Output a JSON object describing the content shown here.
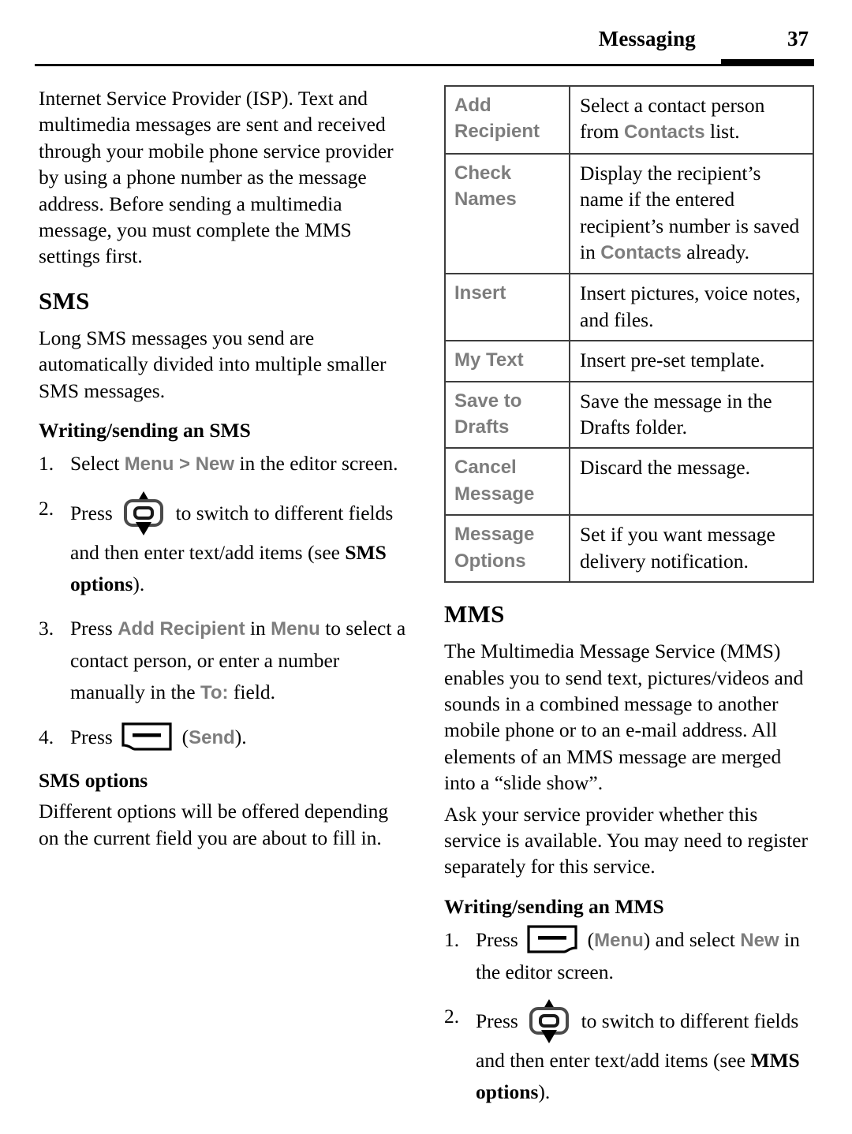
{
  "header": {
    "title": "Messaging",
    "page_number": "37"
  },
  "left_column": {
    "intro_paragraph": "Internet Service Provider (ISP). Text and multimedia messages are sent and received through your mobile phone service provider by using a phone number as the message address. Before sending a multimedia message, you must complete the MMS settings first.",
    "sms_heading": "SMS",
    "sms_paragraph": "Long SMS messages you send are automatically divided into multiple smaller SMS messages.",
    "writing_heading": "Writing/sending an SMS",
    "steps": {
      "step1": {
        "pre": "Select ",
        "ui1": "Menu",
        "mid1": " > ",
        "ui2": "New",
        "post": " in the editor screen."
      },
      "step2": {
        "pre": "Press ",
        "icon": "navigation-key-icon",
        "mid": " to switch to different fields and then enter text/add items (see ",
        "bold": "SMS options",
        "post": ")."
      },
      "step3": {
        "pre": "Press ",
        "ui1": "Add Recipient",
        "mid1": " in ",
        "ui2": "Menu",
        "mid2": " to select a contact person, or enter a number manually in the ",
        "ui3": "To:",
        "post": " field."
      },
      "step4": {
        "pre": "Press ",
        "icon": "left-softkey-icon",
        "mid": " (",
        "ui1": "Send",
        "post": ")."
      }
    },
    "options_heading": "SMS options",
    "options_paragraph": "Different options will be offered depending on the current field you are about to fill in."
  },
  "right_column": {
    "options_table": {
      "rows": [
        {
          "key": "Add Recipient",
          "value_parts": [
            {
              "text": "Select a contact person from ",
              "style": "plain"
            },
            {
              "text": "Contacts",
              "style": "ui"
            },
            {
              "text": " list.",
              "style": "plain"
            }
          ]
        },
        {
          "key": "Check Names",
          "value_parts": [
            {
              "text": "Display the recipient’s name if the entered recipient’s number is saved in ",
              "style": "plain"
            },
            {
              "text": "Contacts",
              "style": "ui"
            },
            {
              "text": " already.",
              "style": "plain"
            }
          ]
        },
        {
          "key": "Insert",
          "value_parts": [
            {
              "text": "Insert pictures, voice notes, and files.",
              "style": "plain"
            }
          ]
        },
        {
          "key": "My Text",
          "value_parts": [
            {
              "text": "Insert pre-set template.",
              "style": "plain"
            }
          ]
        },
        {
          "key": "Save to Drafts",
          "value_parts": [
            {
              "text": "Save the message in the Drafts folder.",
              "style": "plain"
            }
          ]
        },
        {
          "key": "Cancel Message",
          "value_parts": [
            {
              "text": "Discard the message.",
              "style": "plain"
            }
          ]
        },
        {
          "key": "Message Options",
          "value_parts": [
            {
              "text": "Set if you want message delivery notification.",
              "style": "plain"
            }
          ]
        }
      ]
    },
    "mms_heading": "MMS",
    "mms_paragraph_1": "The Multimedia Message Service (MMS) enables you to send text, pictures/videos and sounds in a combined message to another mobile phone or to an e-mail address. All elements of an MMS message are merged into a “slide show”.",
    "mms_paragraph_2": "Ask your service provider whether this service is available. You may need to register separately for this service.",
    "writing_heading": "Writing/sending an MMS",
    "steps": {
      "step1": {
        "pre": "Press ",
        "icon": "right-softkey-icon",
        "mid1": " (",
        "ui1": "Menu",
        "mid2": ") and select ",
        "ui2": "New",
        "post": " in the editor screen."
      },
      "step2": {
        "pre": "Press ",
        "icon": "navigation-key-icon",
        "mid": " to switch to different fields and then enter text/add items (see ",
        "bold": "MMS options",
        "post": ")."
      }
    }
  },
  "colors": {
    "ui_term_gray": "#7d7d7d",
    "table_border": "#3d3d3d",
    "text_black": "#000000",
    "page_background": "#ffffff"
  }
}
